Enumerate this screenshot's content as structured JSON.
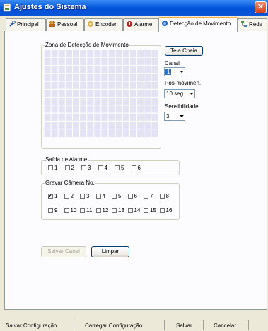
{
  "window": {
    "title": "Ajustes do Sistema",
    "close_glyph": "✕",
    "icon": "settings-window-icon"
  },
  "tabs": [
    {
      "label": "Principal",
      "icon": "wrench-icon",
      "active": false
    },
    {
      "label": "Pessoal",
      "icon": "people-icon",
      "active": false
    },
    {
      "label": "Encoder",
      "icon": "encoder-icon",
      "active": false
    },
    {
      "label": "Alarme",
      "icon": "alarm-icon",
      "active": false
    },
    {
      "label": "Detecção de Movimento",
      "icon": "motion-detection-icon",
      "active": true
    },
    {
      "label": "Rede",
      "icon": "network-icon",
      "active": false
    }
  ],
  "motion_zone": {
    "label": "Zona de Detecção de Movimento",
    "rows": 11,
    "cols": 16,
    "grid_color": "#e3e3f4"
  },
  "fullscreen_button": "Tela Cheia",
  "channel": {
    "label": "Canal",
    "value": "1"
  },
  "post_motion": {
    "label": "Pós-movimen.",
    "value": "10 seg"
  },
  "sensitivity": {
    "label": "Sensibilidade",
    "value": "3"
  },
  "alarm_output": {
    "label": "Saída de Alarme",
    "items": [
      {
        "label": "1",
        "checked": false
      },
      {
        "label": "2",
        "checked": false
      },
      {
        "label": "3",
        "checked": false
      },
      {
        "label": "4",
        "checked": false
      },
      {
        "label": "5",
        "checked": false
      },
      {
        "label": "6",
        "checked": false
      }
    ]
  },
  "record_camera": {
    "label": "Gravar Câmera No.",
    "items": [
      {
        "label": "1",
        "checked": true
      },
      {
        "label": "2",
        "checked": false
      },
      {
        "label": "3",
        "checked": false
      },
      {
        "label": "4",
        "checked": false
      },
      {
        "label": "5",
        "checked": false
      },
      {
        "label": "6",
        "checked": false
      },
      {
        "label": "7",
        "checked": false
      },
      {
        "label": "8",
        "checked": false
      },
      {
        "label": "9",
        "checked": false
      },
      {
        "label": "10",
        "checked": false
      },
      {
        "label": "11",
        "checked": false
      },
      {
        "label": "12",
        "checked": false
      },
      {
        "label": "13",
        "checked": false
      },
      {
        "label": "14",
        "checked": false
      },
      {
        "label": "15",
        "checked": false
      },
      {
        "label": "16",
        "checked": false
      }
    ]
  },
  "actions": {
    "save_channel": "Salvar Canal",
    "clear": "Limpar"
  },
  "footer": {
    "save_config": "Salvar Configuração",
    "load_config": "Carregar Configuração",
    "save": "Salvar",
    "cancel": "Cancelar"
  }
}
